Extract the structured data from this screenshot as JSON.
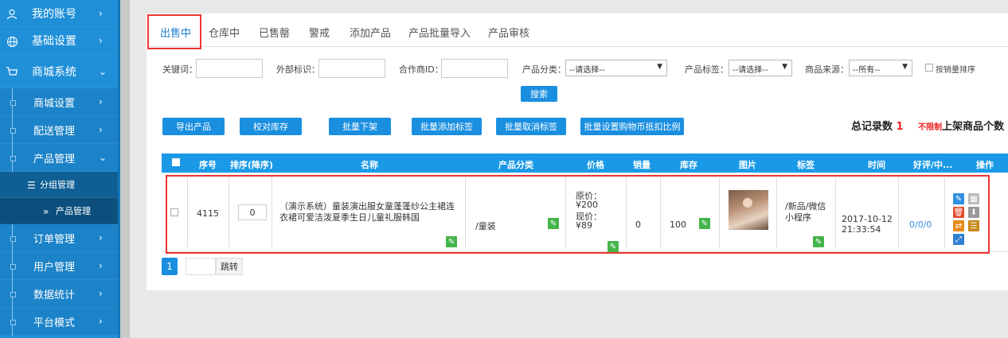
{
  "sidebar": {
    "items": [
      {
        "label": "我的账号",
        "icon": "user-icon"
      },
      {
        "label": "基础设置",
        "icon": "globe-icon"
      },
      {
        "label": "商城系统",
        "icon": "cart-icon"
      },
      {
        "label": "商城设置"
      },
      {
        "label": "配送管理"
      },
      {
        "label": "产品管理"
      },
      {
        "label": "分组管理",
        "icon": "list-icon"
      },
      {
        "label": "产品管理",
        "icon": "double-chevron-icon"
      },
      {
        "label": "订单管理"
      },
      {
        "label": "用户管理"
      },
      {
        "label": "数据统计"
      },
      {
        "label": "平台模式"
      }
    ]
  },
  "tabs": [
    "出售中",
    "仓库中",
    "已售罄",
    "警戒",
    "添加产品",
    "产品批量导入",
    "产品审核"
  ],
  "filters": {
    "keyword_label": "关键词：",
    "external_label": "外部标识：",
    "partner_label": "合作商ID：",
    "category_label": "产品分类：",
    "category_value": "--请选择--",
    "tag_label": "产品标签：",
    "tag_value": "--请选择--",
    "source_label": "商品来源：",
    "source_value": "--所有--",
    "sort_by_sales_label": "按销量排序",
    "search_button": "搜索"
  },
  "actions": [
    "导出产品",
    "校对库存",
    "批量下架",
    "批量添加标签",
    "批量取消标签",
    "批量设置购物币抵扣比例"
  ],
  "summary": {
    "total_label": "总记录数",
    "total_value": "1",
    "limit_label": "不限制",
    "shelf_label": "上架商品个数"
  },
  "table": {
    "headers": [
      "序号",
      "排序(降序)",
      "名称",
      "产品分类",
      "价格",
      "销量",
      "库存",
      "图片",
      "标签",
      "时间",
      "好评/中...",
      "操作"
    ],
    "rows": [
      {
        "id": "4115",
        "sort": "0",
        "name": "（演示系统）童装演出服女童蓬蓬纱公主裙连衣裙可爱洁泼夏季生日儿童礼服韩国",
        "category": "/童装",
        "price_original_label": "原价：",
        "price_original": "¥200",
        "price_current_label": "现价：",
        "price_current": "¥89",
        "sales": "0",
        "stock": "100",
        "tags": "/新品/微信小程序",
        "time": "2017-10-12 21:33:54",
        "rating": "0/0/0"
      }
    ]
  },
  "pager": {
    "current": "1",
    "go_label": "跳转"
  },
  "colors": {
    "accent": "#1a8fe0",
    "highlight": "#e33333",
    "sidebar": "#1f8fd8",
    "edit": "#44b54a"
  }
}
